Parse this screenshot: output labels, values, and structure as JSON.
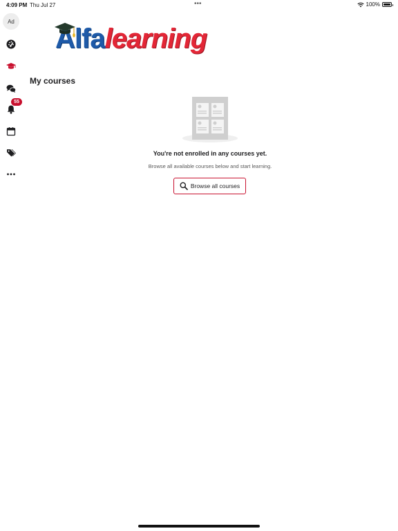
{
  "status_bar": {
    "time": "4:09 PM",
    "date": "Thu Jul 27",
    "dots": "•••",
    "battery_text": "100%",
    "battery_level_pct": 100
  },
  "sidebar": {
    "avatar_text": "Ad",
    "items": [
      {
        "name": "dashboard",
        "icon": "gauge-icon"
      },
      {
        "name": "my-courses",
        "icon": "graduation-cap-icon",
        "active": true
      },
      {
        "name": "messages",
        "icon": "chat-bubbles-icon"
      },
      {
        "name": "notifications",
        "icon": "bell-icon",
        "badge": "55"
      },
      {
        "name": "calendar",
        "icon": "calendar-icon"
      },
      {
        "name": "tags",
        "icon": "tags-icon"
      },
      {
        "name": "more",
        "icon": "ellipsis-icon"
      }
    ]
  },
  "logo": {
    "part1": "Alfa",
    "part2": "learning"
  },
  "page": {
    "title": "My courses"
  },
  "empty_state": {
    "heading": "You're not enrolled in any courses yet.",
    "subtext": "Browse all available courses below and start learning.",
    "button_label": "Browse all courses"
  },
  "colors": {
    "accent": "#c8102e",
    "logo_blue": "#1e5aa8",
    "logo_red": "#e32636",
    "icon_dark": "#1d1d1f"
  }
}
